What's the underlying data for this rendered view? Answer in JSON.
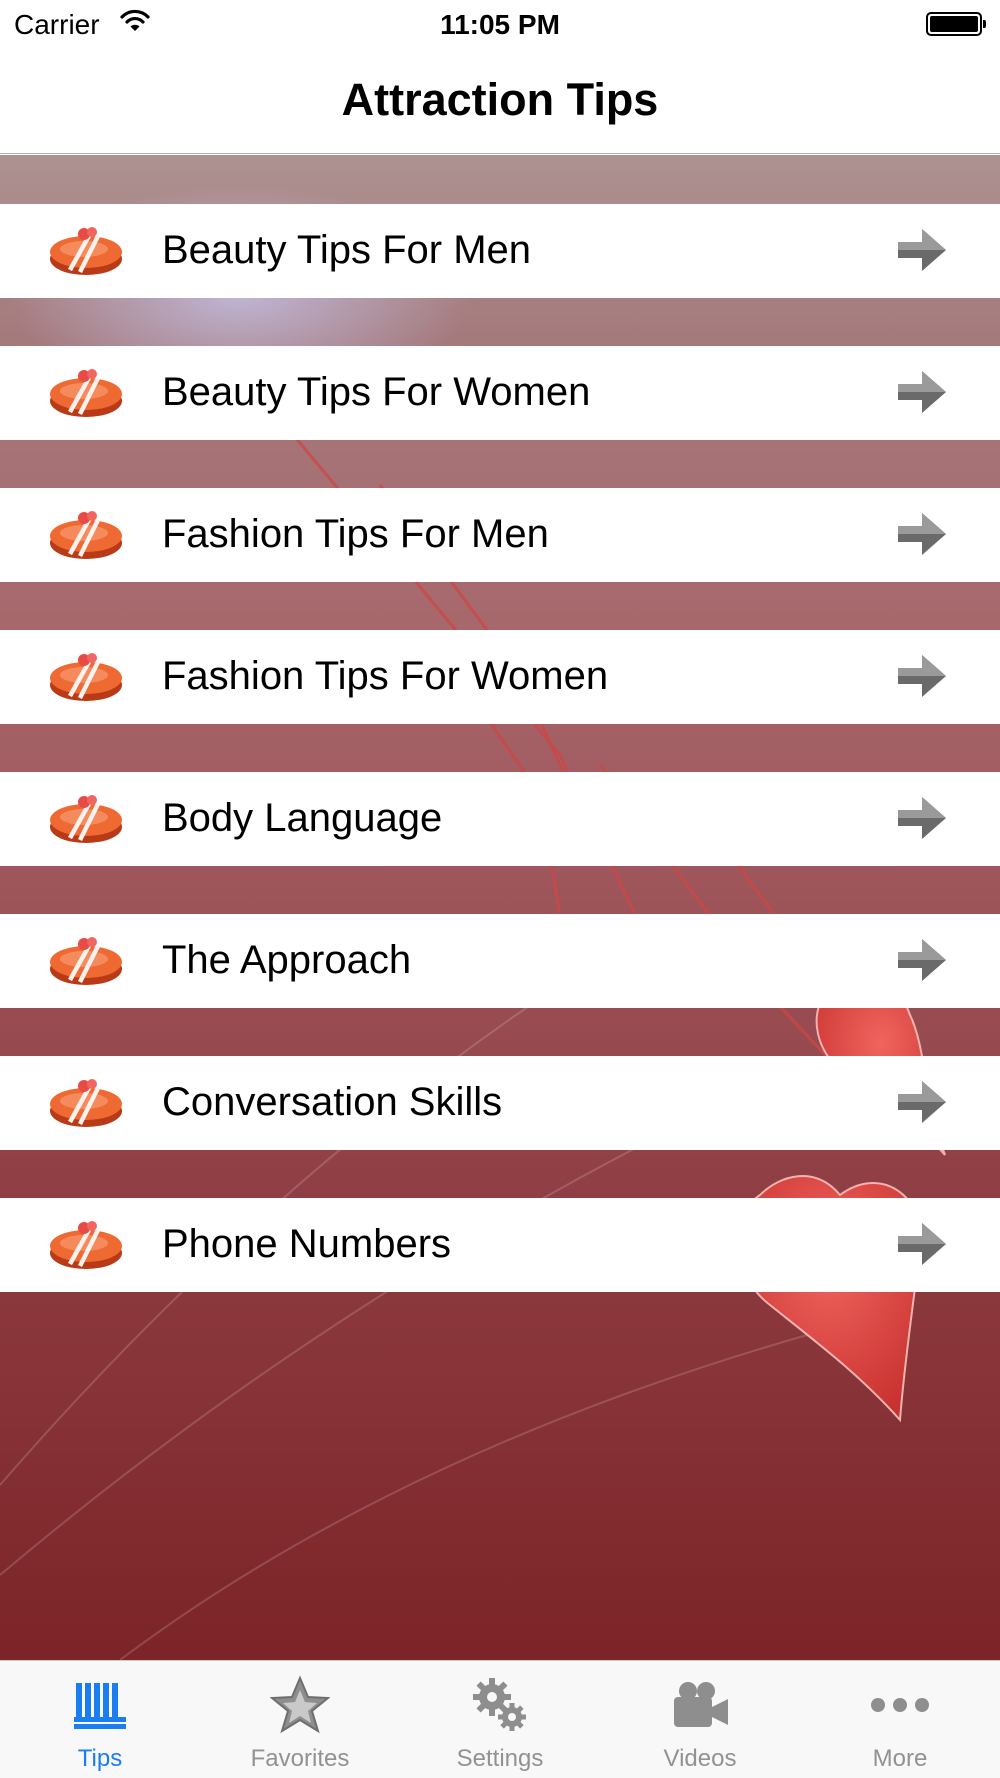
{
  "status_bar": {
    "carrier": "Carrier",
    "time": "11:05 PM"
  },
  "nav": {
    "title": "Attraction Tips"
  },
  "tips": [
    {
      "label": "Beauty Tips For Men"
    },
    {
      "label": "Beauty Tips For Women"
    },
    {
      "label": "Fashion Tips For Men"
    },
    {
      "label": "Fashion Tips For Women"
    },
    {
      "label": "Body Language"
    },
    {
      "label": "The Approach"
    },
    {
      "label": "Conversation Skills"
    },
    {
      "label": "Phone Numbers"
    }
  ],
  "tab_bar": {
    "tabs": [
      {
        "label": "Tips",
        "icon": "tips-icon",
        "active": true
      },
      {
        "label": "Favorites",
        "icon": "star-icon",
        "active": false
      },
      {
        "label": "Settings",
        "icon": "gears-icon",
        "active": false
      },
      {
        "label": "Videos",
        "icon": "video-camera-icon",
        "active": false
      },
      {
        "label": "More",
        "icon": "more-dots-icon",
        "active": false
      }
    ]
  },
  "colors": {
    "accent": "#1a7ef0",
    "inactive_tab": "#929292",
    "background_top": "#ad9191",
    "background_bottom": "#7c2428"
  }
}
